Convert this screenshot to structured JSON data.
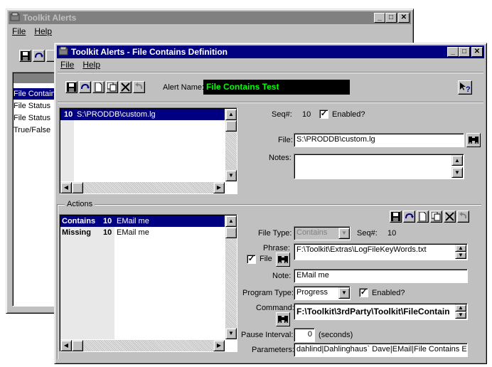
{
  "back_window": {
    "title": "Toolkit Alerts",
    "menu": [
      "File",
      "Help"
    ],
    "list_items": [
      "File Contains",
      "File Status",
      "File Status",
      "True/False"
    ]
  },
  "front_window": {
    "title": "Toolkit Alerts - File Contains Definition",
    "menu": [
      "File",
      "Help"
    ],
    "alert_name_label": "Alert Name:",
    "alert_name_value": "File Contains Test",
    "file_list": [
      {
        "num": "10",
        "path": "S:\\PRODDB\\custom.lg"
      }
    ],
    "seq_label": "Seq#:",
    "seq_value": "10",
    "enabled_label": "Enabled?",
    "file_label": "File:",
    "file_value": "S:\\PRODDB\\custom.lg",
    "notes_label": "Notes:",
    "notes_value": "",
    "actions_label": "Actions",
    "actions": [
      {
        "type": "Contains",
        "num": "10",
        "name": "EMail me"
      },
      {
        "type": "Missing",
        "num": "10",
        "name": "EMail me"
      }
    ],
    "action_detail": {
      "file_type_label": "File Type:",
      "file_type_value": "Contains",
      "seq_label": "Seq#:",
      "seq_value": "10",
      "phrase_label": "Phrase:",
      "phrase_value": "F:\\Toolkit\\Extras\\LogFileKeyWords.txt",
      "file_check_label": "File",
      "note_label": "Note:",
      "note_value": "EMail me",
      "program_type_label": "Program Type:",
      "program_type_value": "Progress",
      "enabled_label": "Enabled?",
      "command_label": "Command:",
      "command_value": "F:\\Toolkit\\3rdParty\\Toolkit\\FileContain",
      "pause_label": "Pause Interval:",
      "pause_value": "0",
      "pause_unit": "(seconds)",
      "parameters_label": "Parameters:",
      "parameters_value": "dahlind|Dahlinghaus` Dave|EMail|File Contains Erro"
    }
  },
  "colors": {
    "active_title": "#000080",
    "inactive_title": "#808080",
    "alert_name_bg": "#000000",
    "alert_name_fg": "#00ff00",
    "selection": "#000080"
  }
}
